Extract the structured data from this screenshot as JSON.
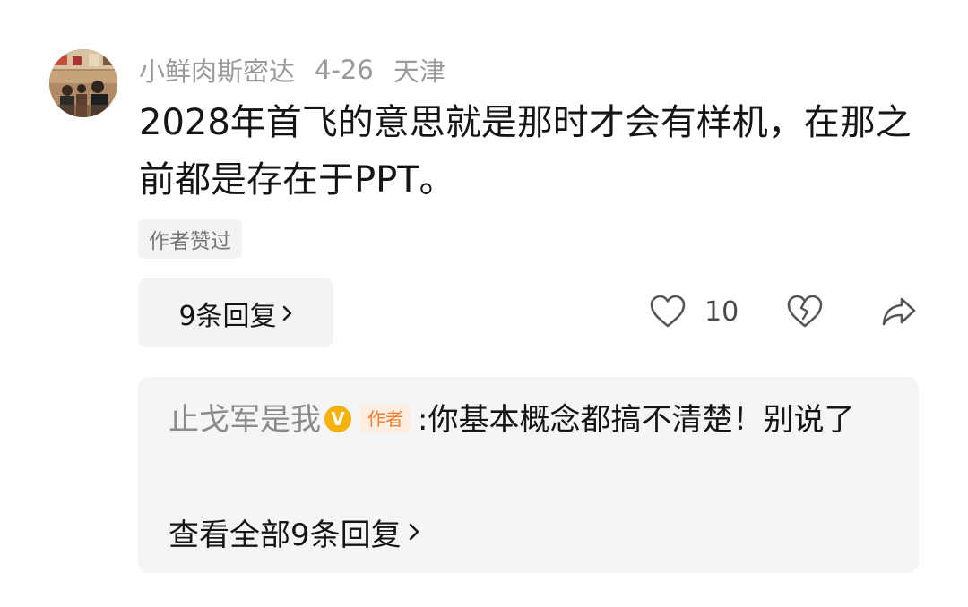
{
  "comment": {
    "username": "小鲜肉斯密达",
    "date": "4-26",
    "location": "天津",
    "text": "2028年首飞的意思就是那时才会有样机，在那之前都是存在于PPT。",
    "author_liked_label": "作者赞过",
    "replies_label": "9条回复",
    "like_count": "10",
    "avatar_icon": "avatar-photo",
    "like_icon": "heart-outline-icon",
    "dislike_icon": "broken-heart-icon",
    "share_icon": "share-arrow-icon"
  },
  "reply_preview": {
    "name": "止戈军是我",
    "verified_badge": "V",
    "author_tag": "作者",
    "colon": ":",
    "text": "你基本概念都搞不清楚！别说了",
    "view_all_label": "查看全部9条回复"
  },
  "colors": {
    "meta_gray": "#9a9a9a",
    "chip_bg": "#f3f3f3",
    "reply_bg": "#f5f5f5",
    "badge_gold": "#f4b20e",
    "author_tag_orange": "#f07d2c"
  }
}
